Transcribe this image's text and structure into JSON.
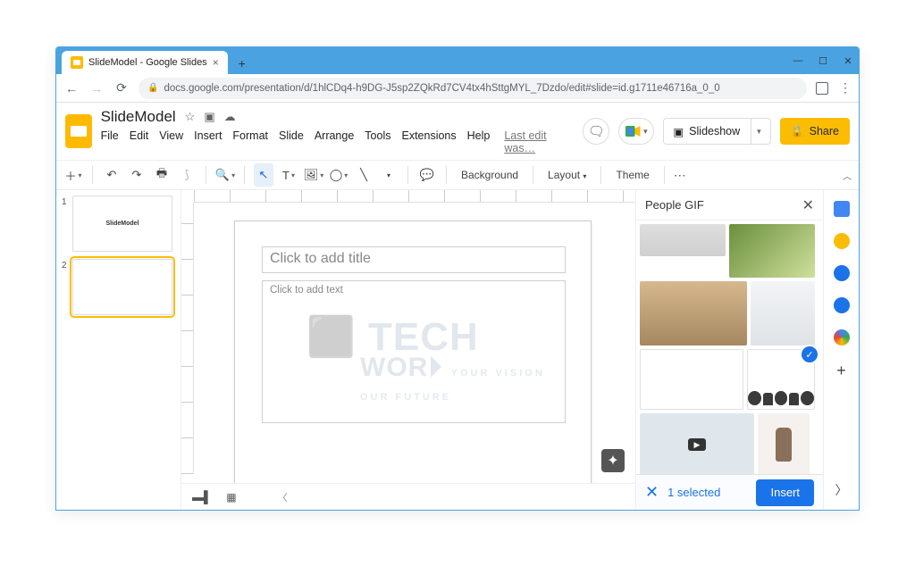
{
  "browser": {
    "tab_title": "SlideModel - Google Slides",
    "url": "docs.google.com/presentation/d/1hlCDq4-h9DG-J5sp2ZQkRd7CV4tx4hSttgMYL_7Dzdo/edit#slide=id.g1711e46716a_0_0"
  },
  "doc": {
    "title": "SlideModel",
    "menus": [
      "File",
      "Edit",
      "View",
      "Insert",
      "Format",
      "Slide",
      "Arrange",
      "Tools",
      "Extensions",
      "Help"
    ],
    "last_edit": "Last edit was…",
    "slideshow": "Slideshow",
    "share": "Share"
  },
  "toolbar": {
    "background": "Background",
    "layout": "Layout",
    "theme": "Theme"
  },
  "thumbs": {
    "slide1_label": "SlideModel",
    "n1": "1",
    "n2": "2"
  },
  "slide": {
    "title_ph": "Click to add title",
    "body_ph": "Click to add text"
  },
  "search": {
    "title": "People GIF",
    "selected": "1 selected",
    "insert": "Insert"
  },
  "colors": {
    "accent": "#1a73e8",
    "share": "#fbbc04"
  }
}
